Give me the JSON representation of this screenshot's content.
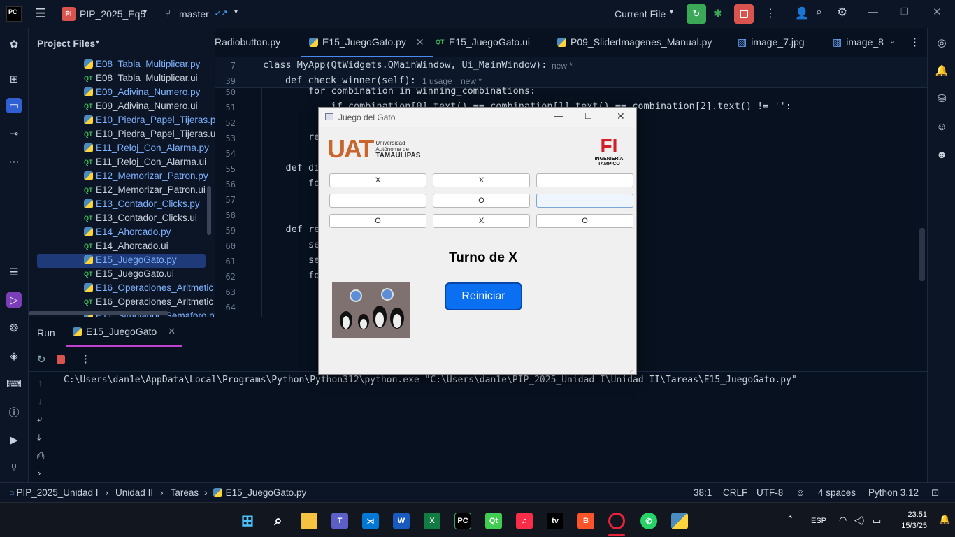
{
  "app": {
    "logo": "PC",
    "project_badge": "PI",
    "project_name": "PIP_2025_Eq5",
    "branch": "master",
    "run_config": "Current File"
  },
  "colors": {
    "accent": "#2f5fd0",
    "run_green": "#3aa856",
    "stop_red": "#d9534f",
    "button_blue": "#0a6ff0"
  },
  "project_panel": {
    "title": "Project Files",
    "items": [
      {
        "label": "E08_Tabla_Multiplicar.py",
        "type": "py"
      },
      {
        "label": "E08_Tabla_Multiplicar.ui",
        "type": "ui"
      },
      {
        "label": "E09_Adivina_Numero.py",
        "type": "py"
      },
      {
        "label": "E09_Adivina_Numero.ui",
        "type": "ui"
      },
      {
        "label": "E10_Piedra_Papel_Tijeras.py",
        "type": "py"
      },
      {
        "label": "E10_Piedra_Papel_Tijeras.ui",
        "type": "ui"
      },
      {
        "label": "E11_Reloj_Con_Alarma.py",
        "type": "py"
      },
      {
        "label": "E11_Reloj_Con_Alarma.ui",
        "type": "ui"
      },
      {
        "label": "E12_Memorizar_Patron.py",
        "type": "py"
      },
      {
        "label": "E12_Memorizar_Patron.ui",
        "type": "ui"
      },
      {
        "label": "E13_Contador_Clicks.py",
        "type": "py"
      },
      {
        "label": "E13_Contador_Clicks.ui",
        "type": "ui"
      },
      {
        "label": "E14_Ahorcado.py",
        "type": "py"
      },
      {
        "label": "E14_Ahorcado.ui",
        "type": "ui"
      },
      {
        "label": "E15_JuegoGato.py",
        "type": "py"
      },
      {
        "label": "E15_JuegoGato.ui",
        "type": "ui"
      },
      {
        "label": "E16_Operaciones_Aritmetic",
        "type": "py"
      },
      {
        "label": "E16_Operaciones_Aritmetic",
        "type": "ui"
      },
      {
        "label": "E17_Simulador_Semaforo.py",
        "type": "py"
      }
    ]
  },
  "tabs": [
    {
      "label": "Radiobutton.py"
    },
    {
      "label": "E15_JuegoGato.py",
      "active": true
    },
    {
      "label": "E15_JuegoGato.ui"
    },
    {
      "label": "P09_SliderImagenes_Manual.py"
    },
    {
      "label": "image_7.jpg"
    },
    {
      "label": "image_8"
    }
  ],
  "editor": {
    "sticky1": {
      "line": "7",
      "text": "class MyApp(QtWidgets.QMainWindow, Ui_MainWindow):",
      "hint": "new *"
    },
    "sticky2": {
      "line": "39",
      "text": "def check_winner(self):",
      "usage": "1 usage",
      "hint": "new *"
    },
    "lines": [
      {
        "n": "50",
        "t": "        for combination in winning_combinations:"
      },
      {
        "n": "51",
        "t": "            if combination[0].text() == combination[1].text() == combination[2].text() != '':"
      },
      {
        "n": "52",
        "t": ""
      },
      {
        "n": "53",
        "t": "        re"
      },
      {
        "n": "54",
        "t": ""
      },
      {
        "n": "55",
        "t": "    def di"
      },
      {
        "n": "56",
        "t": "        fo"
      },
      {
        "n": "57",
        "t": ""
      },
      {
        "n": "58",
        "t": ""
      },
      {
        "n": "59",
        "t": "    def re"
      },
      {
        "n": "60",
        "t": "        se"
      },
      {
        "n": "61",
        "t": "        se"
      },
      {
        "n": "62",
        "t": "        fo"
      },
      {
        "n": "63",
        "t": ""
      },
      {
        "n": "64",
        "t": ""
      }
    ]
  },
  "run_panel": {
    "tab_run": "Run",
    "tab_config": "E15_JuegoGato",
    "console": "C:\\Users\\dan1e\\AppData\\Local\\Programs\\Python\\Python312\\python.exe \"C:\\Users\\dan1e\\PIP_2025_Unidad I\\Unidad II\\Tareas\\E15_JuegoGato.py\""
  },
  "status": {
    "crumbs": [
      "PIP_2025_Unidad I",
      "Unidad II",
      "Tareas",
      "E15_JuegoGato.py"
    ],
    "position": "38:1",
    "line_ending": "CRLF",
    "encoding": "UTF-8",
    "indent": "4 spaces",
    "interpreter": "Python 3.12"
  },
  "dialog": {
    "title": "Juego del Gato",
    "uat_logo": "UAT",
    "uat_line1": "Universidad",
    "uat_line2": "Autónoma de",
    "uat_line3": "TAMAULIPAS",
    "fi_logo": "FI",
    "fi_line1": "INGENIERÍA",
    "fi_line2": "TAMPICO",
    "board": [
      "X",
      "X",
      "",
      "",
      "O",
      "",
      "O",
      "X",
      "O"
    ],
    "turn": "Turno de X",
    "reset": "Reiniciar"
  },
  "taskbar": {
    "lang": "ESP",
    "time": "23:51",
    "date": "15/3/25"
  }
}
